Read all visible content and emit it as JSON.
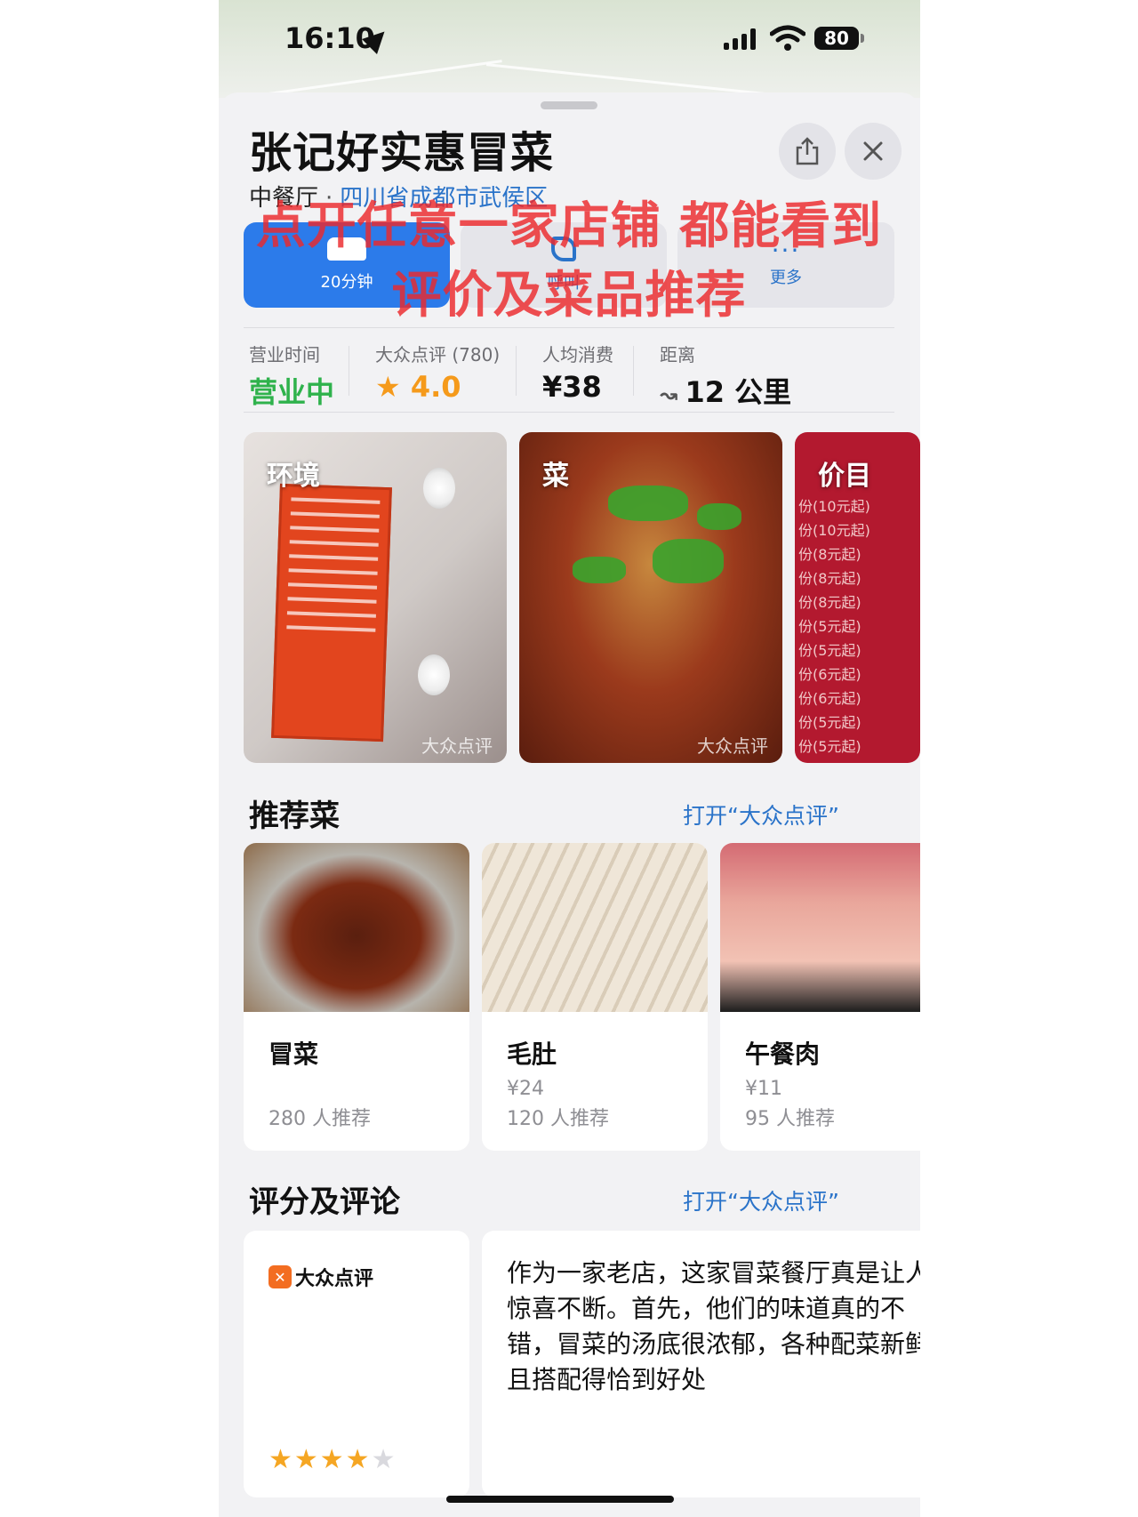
{
  "status": {
    "time": "16:10",
    "battery": "80"
  },
  "place": {
    "name": "张记好实惠冒菜",
    "category": "中餐厅",
    "separator": "·",
    "region": "四川省成都市武侯区"
  },
  "actions": [
    {
      "label": "20分钟",
      "icon": "car-icon"
    },
    {
      "label": "呼叫",
      "icon": "phone-icon"
    },
    {
      "label": "更多",
      "icon": "more-icon"
    }
  ],
  "overlay_caption": "点开任意一家店铺 都能看到评价及菜品推荐",
  "info": {
    "hours_label": "营业时间",
    "hours_value": "营业中",
    "rating_label": "大众点评 (780)",
    "rating_value": "4.0",
    "price_label": "人均消费",
    "price_value": "¥38",
    "distance_label": "距离",
    "distance_value": "12 公里"
  },
  "photos": {
    "items": [
      "环境",
      "菜",
      "价目"
    ],
    "watermark": "大众点评",
    "price_rows": [
      "份(10元起)",
      "份(10元起)",
      "份(8元起)",
      "份(8元起)",
      "份(8元起)",
      "份(5元起)",
      "份(5元起)",
      "份(6元起)",
      "份(6元起)",
      "份(5元起)",
      "份(5元起)"
    ]
  },
  "recommended": {
    "title": "推荐菜",
    "link": "打开“大众点评”",
    "dishes": [
      {
        "name": "冒菜",
        "price": "",
        "count": "280 人推荐"
      },
      {
        "name": "毛肚",
        "price": "¥24",
        "count": "120 人推荐"
      },
      {
        "name": "午餐肉",
        "price": "¥11",
        "count": "95 人推荐"
      }
    ]
  },
  "reviews": {
    "title": "评分及评论",
    "link": "打开“大众点评”",
    "source": "大众点评",
    "stars": 4,
    "text": "作为一家老店，这家冒菜餐厅真是让人惊喜不断。首先，他们的味道真的不错，冒菜的汤底很浓郁，各种配菜新鲜且搭配得恰到好处"
  },
  "colors": {
    "accent": "#2a73c9",
    "drive_button": "#2c7bea",
    "open_status": "#2fb24c",
    "star": "#f59a1b",
    "overlay_text": "#ec282c"
  }
}
